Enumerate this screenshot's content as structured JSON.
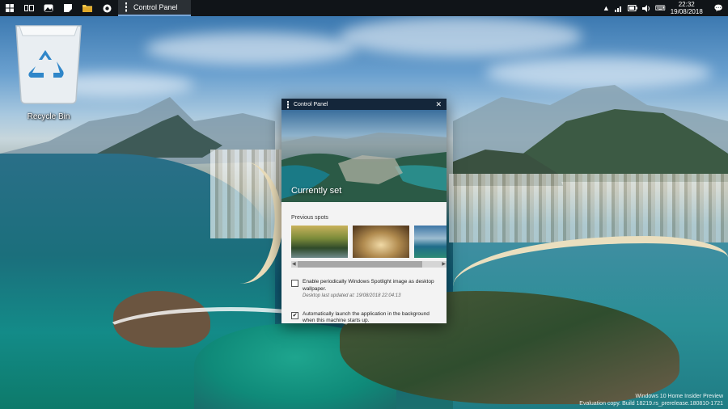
{
  "taskbar": {
    "apps": [
      {
        "name": "start",
        "icon": "windows-logo-icon"
      },
      {
        "name": "task-view",
        "icon": "task-view-icon"
      },
      {
        "name": "photos",
        "icon": "photos-icon"
      },
      {
        "name": "notes",
        "icon": "notes-icon"
      },
      {
        "name": "file-explorer",
        "icon": "folder-icon"
      },
      {
        "name": "browser",
        "icon": "browser-icon"
      }
    ],
    "active_app_label": "Control Panel",
    "clock_time": "22:32",
    "clock_date": "19/08/2018",
    "tray_chevron": "▲",
    "notification_icon": "💬"
  },
  "desktop": {
    "recycle_bin_label": "Recycle Bin"
  },
  "dialog": {
    "title": "Control Panel",
    "close_glyph": "✕",
    "hero_caption": "Currently set",
    "previous_spots_label": "Previous spots",
    "option_1_label": "Enable periodically Windows Spotlight image as desktop wallpaper.",
    "option_1_sub": "Desktop last updated at: 19/08/2018 22:04:13",
    "option_1_checked": false,
    "option_2_label": "Automatically launch the application in the background when this machine starts up.",
    "option_2_checked": true
  },
  "watermark": {
    "line1": "Windows 10 Home Insider Preview",
    "line2": "Evaluation copy. Build 18219.rs_prerelease.180810-1721"
  },
  "colors": {
    "taskbar_bg": "#101418",
    "dialog_titlebar": "#14263a",
    "active_app_accent": "#7aa7d8"
  }
}
